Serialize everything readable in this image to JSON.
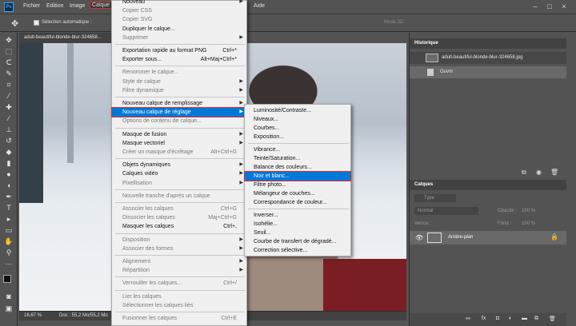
{
  "menubar": {
    "logo": "Ps",
    "items": [
      "Fichier",
      "Edition",
      "Image",
      "Calque",
      "Aide"
    ],
    "active": "Calque"
  },
  "options": {
    "auto_select_label": "Sélection automatique :",
    "mode_3d_label": "Mode 3D :"
  },
  "document": {
    "tab_title": "adult-beautiful-blonde-blur-324658...",
    "zoom": "16,67 %",
    "doc_info": "Doc : 55,2 Mo/55,2 Mo"
  },
  "history_panel": {
    "title": "Historique",
    "snapshot_label": "adult-beautiful-blonde-blur-324658.jpg",
    "steps": [
      "Ouvrir"
    ]
  },
  "layers_panel": {
    "title": "Calques",
    "filter_placeholder": "Type",
    "blend_mode": "Normal",
    "opacity_label": "Opacité :",
    "opacity_value": "100 %",
    "lock_label": "Verrou :",
    "fill_label": "Fond :",
    "fill_value": "100 %",
    "layers": [
      {
        "name": "Arrière-plan"
      }
    ]
  },
  "calque_menu": {
    "items": [
      {
        "label": "Nouveau",
        "disabled": false,
        "submenu": true
      },
      {
        "label": "Copier CSS",
        "disabled": true
      },
      {
        "label": "Copier SVG",
        "disabled": true
      },
      {
        "label": "Dupliquer le calque...",
        "disabled": false
      },
      {
        "label": "Supprimer",
        "disabled": true,
        "submenu": true
      },
      {
        "sep": true
      },
      {
        "label": "Exportation rapide au format PNG",
        "shortcut": "Ctrl+*",
        "disabled": false
      },
      {
        "label": "Exporter sous...",
        "shortcut": "Alt+Maj+Ctrl+*",
        "disabled": false
      },
      {
        "sep": true
      },
      {
        "label": "Renommer le calque...",
        "disabled": true
      },
      {
        "label": "Style de calque",
        "disabled": true,
        "submenu": true
      },
      {
        "label": "Filtre dynamique",
        "disabled": true,
        "submenu": true
      },
      {
        "sep": true
      },
      {
        "label": "Nouveau calque de remplissage",
        "disabled": false,
        "submenu": true
      },
      {
        "label": "Nouveau calque de réglage",
        "disabled": false,
        "submenu": true,
        "highlight": true
      },
      {
        "label": "Options de contenu de calque...",
        "disabled": true
      },
      {
        "sep": true
      },
      {
        "label": "Masque de fusion",
        "disabled": false,
        "submenu": true
      },
      {
        "label": "Masque vectoriel",
        "disabled": false,
        "submenu": true
      },
      {
        "label": "Créer un masque d'écrêtage",
        "shortcut": "Alt+Ctrl+G",
        "disabled": true
      },
      {
        "sep": true
      },
      {
        "label": "Objets dynamiques",
        "disabled": false,
        "submenu": true
      },
      {
        "label": "Calques vidéo",
        "disabled": false,
        "submenu": true
      },
      {
        "label": "Pixellisation",
        "disabled": true,
        "submenu": true
      },
      {
        "sep": true
      },
      {
        "label": "Nouvelle tranche d'après un calque",
        "disabled": true
      },
      {
        "sep": true
      },
      {
        "label": "Associer les calques",
        "shortcut": "Ctrl+G",
        "disabled": true
      },
      {
        "label": "Dissocier les calques",
        "shortcut": "Maj+Ctrl+G",
        "disabled": true
      },
      {
        "label": "Masquer les calques",
        "shortcut": "Ctrl+,",
        "disabled": false
      },
      {
        "sep": true
      },
      {
        "label": "Disposition",
        "disabled": true,
        "submenu": true
      },
      {
        "label": "Associer des formes",
        "disabled": true,
        "submenu": true
      },
      {
        "sep": true
      },
      {
        "label": "Alignement",
        "disabled": true,
        "submenu": true
      },
      {
        "label": "Répartition",
        "disabled": true,
        "submenu": true
      },
      {
        "sep": true
      },
      {
        "label": "Verrouiller les calques...",
        "shortcut": "Ctrl+/",
        "disabled": true
      },
      {
        "sep": true
      },
      {
        "label": "Lier les calques",
        "disabled": true
      },
      {
        "label": "Sélectionner les calques liés",
        "disabled": true
      },
      {
        "sep": true
      },
      {
        "label": "Fusionner les calques",
        "shortcut": "Ctrl+E",
        "disabled": true
      }
    ]
  },
  "adjust_submenu": {
    "items": [
      {
        "label": "Luminosité/Contraste..."
      },
      {
        "label": "Niveaux..."
      },
      {
        "label": "Courbes..."
      },
      {
        "label": "Exposition..."
      },
      {
        "sep": true
      },
      {
        "label": "Vibrance..."
      },
      {
        "label": "Teinte/Saturation..."
      },
      {
        "label": "Balance des couleurs..."
      },
      {
        "label": "Noir et blanc...",
        "highlight": true
      },
      {
        "label": "Filtre photo..."
      },
      {
        "label": "Mélangeur de couches..."
      },
      {
        "label": "Correspondance de couleur..."
      },
      {
        "sep": true
      },
      {
        "label": "Inverser..."
      },
      {
        "label": "Isohélie..."
      },
      {
        "label": "Seuil..."
      },
      {
        "label": "Courbe de transfert de dégradé..."
      },
      {
        "label": "Correction sélective..."
      }
    ]
  },
  "colors": {
    "highlight": "#0078d7",
    "callout": "#e12c2c",
    "panel_bg": "#535353"
  }
}
